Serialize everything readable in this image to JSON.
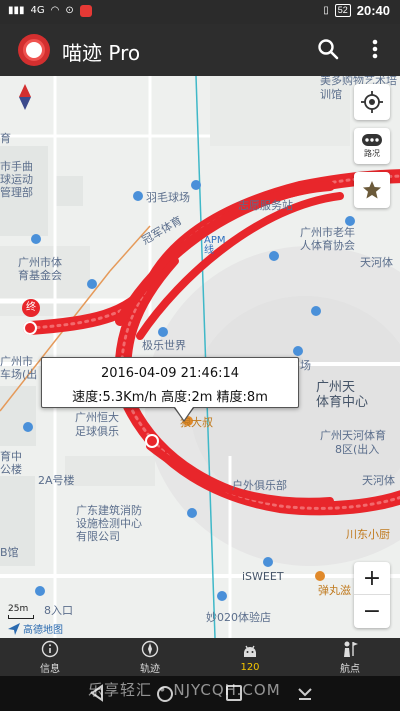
{
  "status_bar": {
    "signal_text": "4G",
    "battery": "52",
    "time": "20:40"
  },
  "app_bar": {
    "title": "喵迹 Pro"
  },
  "map": {
    "right_controls": {
      "traffic_label": "路况"
    },
    "zoom": {
      "in_label": "+",
      "out_label": "−"
    },
    "scale_label": "25m",
    "provider_label": "高德地图",
    "pois": [
      {
        "text": "美多购物艺术培"
      },
      {
        "text": "训馆"
      },
      {
        "text": "育"
      },
      {
        "text": "市手曲"
      },
      {
        "text": "球运动"
      },
      {
        "text": "管理部"
      },
      {
        "text": "羽毛球场"
      },
      {
        "text": "志愿服务站"
      },
      {
        "text": "广州市老年"
      },
      {
        "text": "人体育协会"
      },
      {
        "text": "天河体"
      },
      {
        "text": "广州市体"
      },
      {
        "text": "育基金会"
      },
      {
        "text": "APM线"
      },
      {
        "text": "冠军体育"
      },
      {
        "text": "极乐世界"
      },
      {
        "text": "广州市"
      },
      {
        "text": "车场(出"
      },
      {
        "text": "场"
      },
      {
        "text": "广州天"
      },
      {
        "text": "体育中心"
      },
      {
        "text": "广州恒大"
      },
      {
        "text": "足球俱乐"
      },
      {
        "text": "狼大叔"
      },
      {
        "text": "广州天河体育"
      },
      {
        "text": "8区(出入"
      },
      {
        "text": "育中"
      },
      {
        "text": "公楼"
      },
      {
        "text": "户外俱乐部"
      },
      {
        "text": "天河体"
      },
      {
        "text": "2A号楼"
      },
      {
        "text": "广东建筑消防"
      },
      {
        "text": "设施检测中心"
      },
      {
        "text": "有限公司"
      },
      {
        "text": "川东小厨"
      },
      {
        "text": "B馆"
      },
      {
        "text": "iSWEET"
      },
      {
        "text": "弹丸滋"
      },
      {
        "text": "8入口"
      },
      {
        "text": "妙020体验店"
      },
      {
        "text": "终"
      }
    ]
  },
  "callout": {
    "datetime": "2016-04-09 21:46:14",
    "details": "速度:5.3Km/h 高度:2m 精度:8m"
  },
  "bottom_nav": {
    "items": [
      {
        "label": "信息",
        "icon": "info-icon"
      },
      {
        "label": "轨迹",
        "icon": "track-icon"
      },
      {
        "label": "120",
        "icon": "android-icon",
        "active": true
      },
      {
        "label": "航点",
        "icon": "waypoint-icon"
      }
    ]
  },
  "watermark": "乐享轻汇 • NJYCQH.COM",
  "colors": {
    "track": "#e8262b",
    "app_bar": "#2d2d2d",
    "active_tab": "#f3c400",
    "map_bg": "#eef0ee"
  }
}
